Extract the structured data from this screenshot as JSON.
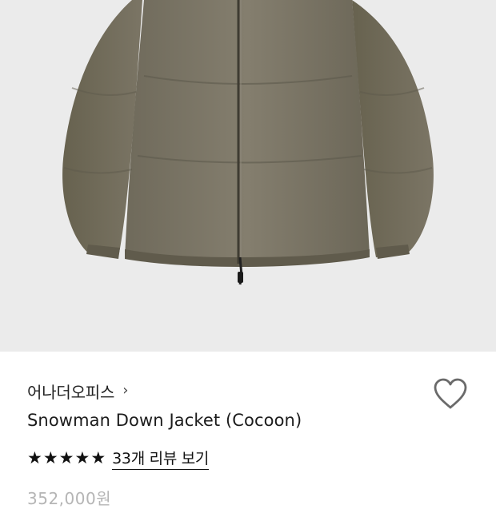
{
  "product": {
    "brand": "어나더오피스",
    "brand_chevron": "›",
    "title": "Snowman Down Jacket (Cocoon)",
    "rating_stars": 5,
    "review_link": "33개 리뷰 보기",
    "price": "352,000원"
  },
  "icons": {
    "brand_chevron": "chevron-right-icon",
    "wishlist": "heart-outline-icon",
    "star": "star-filled-icon"
  },
  "colors": {
    "image_background": "#ebebeb",
    "jacket": "#7a7565",
    "text": "#111111",
    "price": "#b5b5b5"
  }
}
